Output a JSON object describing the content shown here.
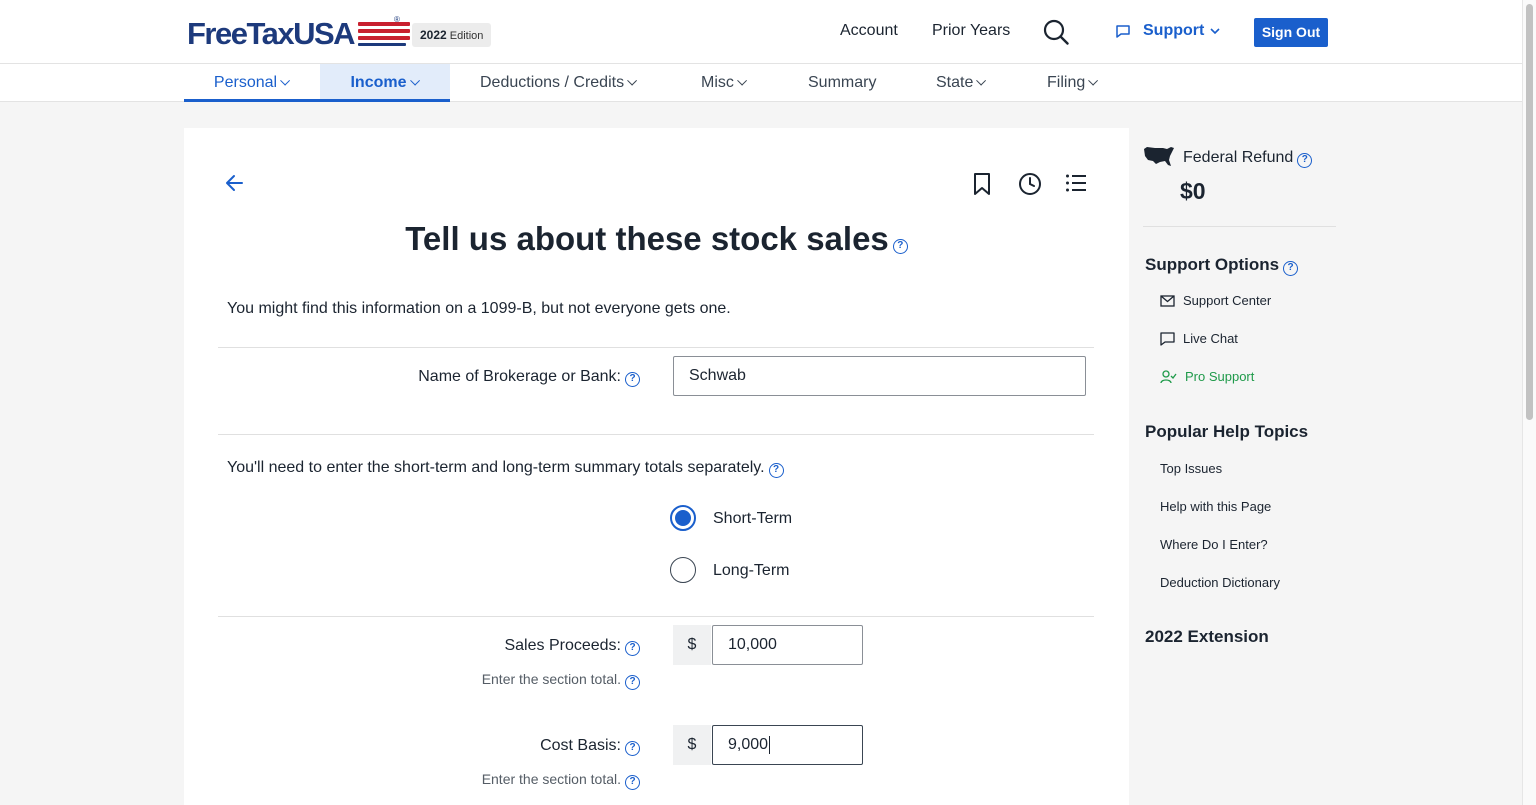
{
  "header": {
    "logo": "FreeTaxUSA",
    "logo_reg": "®",
    "edition_year": "2022",
    "edition_label": "Edition",
    "account": "Account",
    "prior_years": "Prior Years",
    "support": "Support",
    "sign_out": "Sign Out"
  },
  "nav": {
    "personal": "Personal",
    "income": "Income",
    "deductions": "Deductions / Credits",
    "misc": "Misc",
    "summary": "Summary",
    "state": "State",
    "filing": "Filing"
  },
  "main": {
    "title": "Tell us about these stock sales",
    "intro": "You might find this information on a 1099-B, but not everyone gets one.",
    "brokerage_label": "Name of Brokerage or Bank:",
    "brokerage_value": "Schwab",
    "term_note": "You'll need to enter the short-term and long-term summary totals separately.",
    "short_term": "Short-Term",
    "long_term": "Long-Term",
    "selected_term": "Short-Term",
    "sales_label": "Sales Proceeds:",
    "sales_hint": "Enter the section total.",
    "sales_value": "10,000",
    "cost_label": "Cost Basis:",
    "cost_hint": "Enter the section total.",
    "cost_value": "9,000",
    "currency": "$",
    "help_glyph": "?"
  },
  "sidebar": {
    "refund_label": "Federal Refund",
    "refund_amount": "$0",
    "support_options": "Support Options",
    "support_center": "Support Center",
    "live_chat": "Live Chat",
    "pro_support": "Pro Support",
    "popular_topics": "Popular Help Topics",
    "topics": [
      "Top Issues",
      "Help with this Page",
      "Where Do I Enter?",
      "Deduction Dictionary"
    ],
    "extension": "2022 Extension"
  },
  "colors": {
    "accent": "#1a5fcc",
    "pro_support": "#1f9a4a",
    "logo_navy": "#1d3a7c",
    "logo_red": "#c8202f"
  }
}
